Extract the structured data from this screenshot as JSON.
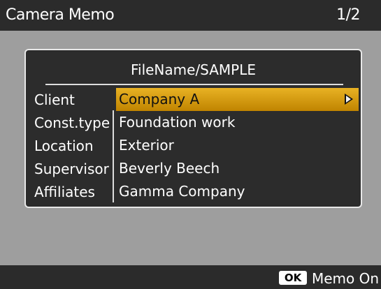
{
  "header": {
    "title": "Camera Memo",
    "page_indicator": "1/2"
  },
  "memo": {
    "file_name": "FileName/SAMPLE",
    "selected_row": "Client",
    "rows": [
      {
        "label": "Client",
        "value": "Company A"
      },
      {
        "label": "Const.type",
        "value": "Foundation work"
      },
      {
        "label": "Location",
        "value": "Exterior"
      },
      {
        "label": "Supervisor",
        "value": "Beverly Beech"
      },
      {
        "label": "Affiliates",
        "value": "Gamma Company"
      }
    ]
  },
  "footer": {
    "ok_key": "OK",
    "action_label": "Memo On"
  },
  "colors": {
    "highlight": "#e0a81a",
    "bar_background": "#2b2b2b",
    "screen_background": "#9e9e9e"
  },
  "icons": {
    "row_arrow": "triangle-right-icon"
  }
}
